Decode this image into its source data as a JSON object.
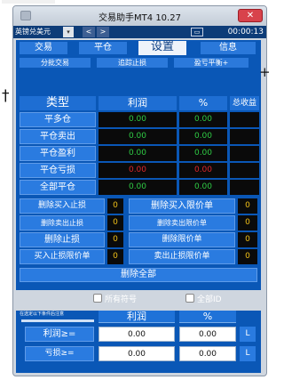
{
  "window": {
    "title": "交易助手MT4 10.27",
    "close_label": "✕"
  },
  "topbar": {
    "symbol": "英镑兑美元",
    "dropdown": "▾",
    "prev": "<",
    "next": ">",
    "folder": "▭",
    "timer": "00:00:13"
  },
  "tabs": [
    "交易",
    "平仓",
    "设置",
    "信息"
  ],
  "subtabs": [
    "分批交易",
    "追踪止损",
    "盈亏平衡+"
  ],
  "table": {
    "headers": [
      "类型",
      "利润",
      "%",
      "总收益"
    ],
    "rows": [
      {
        "label": "平多仓",
        "profit": "0.00",
        "percent": "0.00",
        "profit_color": "g"
      },
      {
        "label": "平仓卖出",
        "profit": "0.00",
        "percent": "0.00",
        "profit_color": "g"
      },
      {
        "label": "平仓盈利",
        "profit": "0.00",
        "percent": "0.00",
        "profit_color": "g"
      },
      {
        "label": "平仓亏损",
        "profit": "0.00",
        "percent": "0.00",
        "profit_color": "r"
      },
      {
        "label": "全部平仓",
        "profit": "0.00",
        "percent": "0.00",
        "profit_color": "g"
      }
    ]
  },
  "delete_rows": [
    {
      "left": "删除买入止损",
      "left_count": "0",
      "right": "删除买入限价单",
      "right_count": "0"
    },
    {
      "left": "删除卖出止损",
      "left_count": "0",
      "right": "删除卖出限价单",
      "right_count": "0"
    },
    {
      "left": "删除止损",
      "left_count": "0",
      "right": "删除限价单",
      "right_count": "0"
    },
    {
      "left": "买入止损限价单",
      "left_count": "0",
      "right": "卖出止损限价单",
      "right_count": "0"
    }
  ],
  "delete_all": "删除全部",
  "checkboxes": {
    "all_symbols": "所有符号",
    "all_id": "全部ID"
  },
  "lower": {
    "caption": "在选定以下条件后注意",
    "headers": [
      "利润",
      "%"
    ],
    "rows": [
      {
        "label": "利润≥=",
        "value": "0.00",
        "percent": "0.00",
        "button": "L"
      },
      {
        "label": "亏损≥=",
        "value": "0.00",
        "percent": "0.00",
        "button": "L"
      }
    ]
  },
  "markers": [
    "+",
    "†"
  ],
  "colors": {
    "panel": "#0a57b6",
    "button": "#2a7be0",
    "profit_green": "#2fcb44",
    "loss_red": "#e0262a",
    "zero_yellow": "#f0c018"
  }
}
